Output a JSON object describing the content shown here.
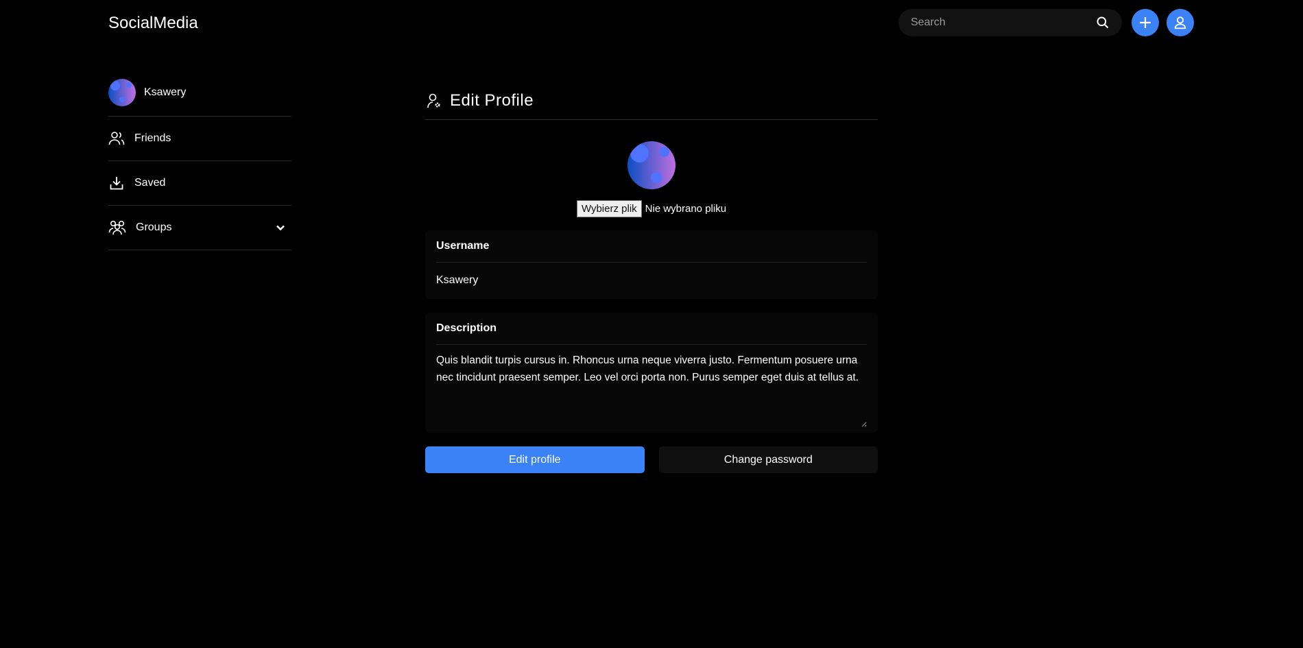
{
  "header": {
    "brand": "SocialMedia",
    "search_placeholder": "Search"
  },
  "sidebar": {
    "user": "Ksawery",
    "items": [
      {
        "label": "Friends",
        "icon": "users-icon"
      },
      {
        "label": "Saved",
        "icon": "download-icon"
      },
      {
        "label": "Groups",
        "icon": "group-icon"
      }
    ]
  },
  "main": {
    "title": "Edit Profile",
    "file_button": "Wybierz plik",
    "file_status": "Nie wybrano pliku",
    "username_label": "Username",
    "username_value": "Ksawery",
    "description_label": "Description",
    "description_value": "Quis blandit turpis cursus in. Rhoncus urna neque viverra justo. Fermentum posuere urna nec tincidunt praesent semper. Leo vel orci porta non. Purus semper eget duis at tellus at.",
    "edit_button": "Edit profile",
    "password_button": "Change password"
  },
  "colors": {
    "accent": "#3b82f6",
    "card": "#070707",
    "secondary_button": "#0f0f0f"
  }
}
